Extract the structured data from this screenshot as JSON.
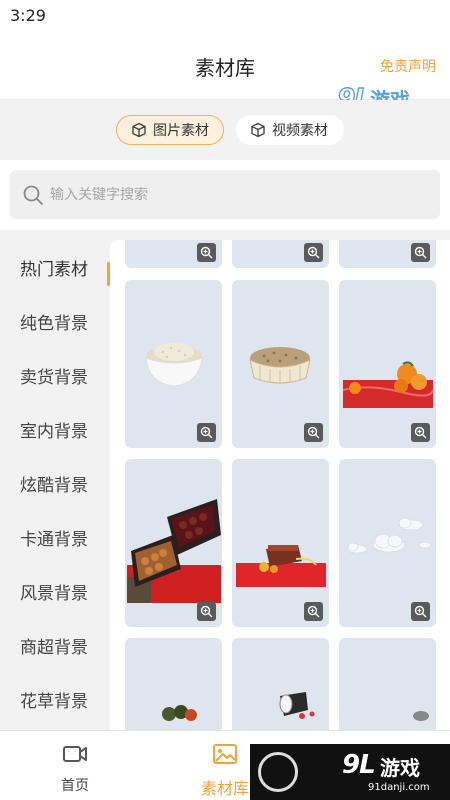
{
  "status_bar": {
    "time": "3:29"
  },
  "header": {
    "title": "素材库",
    "disclaimer": "免责声明"
  },
  "watermark": {
    "logo": "9L",
    "name": "游戏",
    "site": "91danji.com"
  },
  "segment": {
    "tabs": [
      {
        "label": "图片素材",
        "active": true
      },
      {
        "label": "视频素材",
        "active": false
      }
    ]
  },
  "search": {
    "placeholder": "输入关键字搜索"
  },
  "categories": [
    {
      "label": "热门素材",
      "active": true
    },
    {
      "label": "纯色背景"
    },
    {
      "label": "卖货背景"
    },
    {
      "label": "室内背景"
    },
    {
      "label": "炫酷背景"
    },
    {
      "label": "卡通背景"
    },
    {
      "label": "风景背景"
    },
    {
      "label": "商超背景"
    },
    {
      "label": "花草背景"
    }
  ],
  "grid_items": [
    "rice-bowl",
    "grain-basket",
    "oranges-red-cloth",
    "dried-fruit-boxes",
    "cake-red-ribbon",
    "clouds",
    "vegetables",
    "spilled-cup",
    "partial-item"
  ],
  "bottom_nav": [
    {
      "label": "首页",
      "icon": "video-camera-icon",
      "active": false
    },
    {
      "label": "素材库",
      "icon": "image-icon",
      "active": true
    },
    {
      "label": "",
      "icon": "user-icon",
      "active": false
    }
  ],
  "colors": {
    "accent": "#f2a43a",
    "tile_bg": "#dfe5ef"
  }
}
